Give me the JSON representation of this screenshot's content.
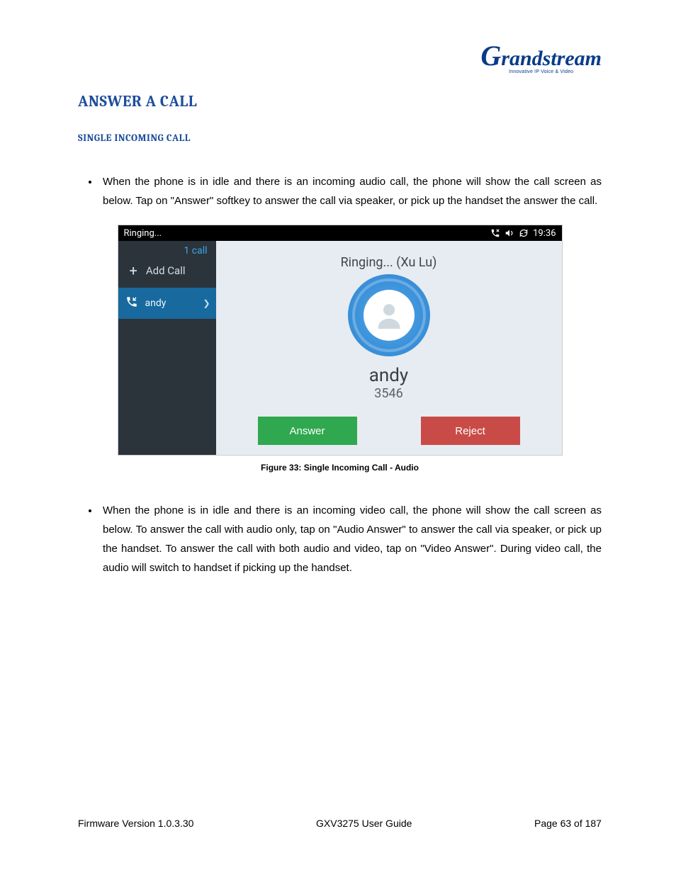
{
  "logo": {
    "brand": "Grandstream",
    "tagline": "Innovative IP Voice & Video"
  },
  "headings": {
    "section": "ANSWER A CALL",
    "subsection": "SINGLE INCOMING CALL"
  },
  "bullets": {
    "b1": "When the phone is in idle and there is an incoming audio call, the phone will show the call screen as below. Tap on \"Answer\" softkey to answer the call via speaker, or pick up the handset the answer the call.",
    "b2": "When the phone is in idle and there is an incoming video call, the phone will show the call screen as below. To answer the call with audio only, tap on \"Audio Answer\" to answer the call via speaker, or pick up the handset. To answer the call with both audio and video, tap on \"Video Answer\". During video call, the audio will switch to handset if picking up the handset."
  },
  "phone": {
    "status_left": "Ringing...",
    "status_time": "19:36",
    "sidebar": {
      "call_count": "1 call",
      "add_call": "Add Call",
      "contact": "andy"
    },
    "main": {
      "ringing_line": "Ringing... (Xu Lu)",
      "caller_name": "andy",
      "caller_number": "3546",
      "answer": "Answer",
      "reject": "Reject"
    }
  },
  "figure_caption": "Figure 33: Single Incoming Call - Audio",
  "footer": {
    "left": "Firmware Version 1.0.3.30",
    "center": "GXV3275 User Guide",
    "right": "Page 63 of 187"
  }
}
